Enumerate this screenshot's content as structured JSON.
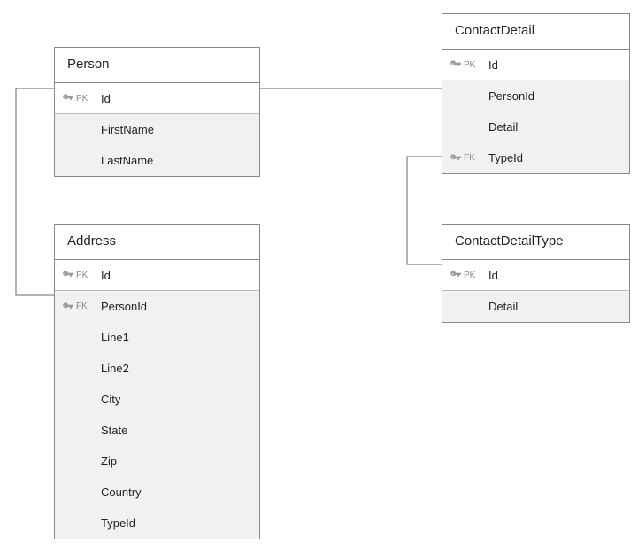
{
  "entities": {
    "person": {
      "title": "Person",
      "cols": {
        "id": {
          "name": "Id",
          "key": "PK"
        },
        "firstName": {
          "name": "FirstName",
          "key": ""
        },
        "lastName": {
          "name": "LastName",
          "key": ""
        }
      }
    },
    "contactDetail": {
      "title": "ContactDetail",
      "cols": {
        "id": {
          "name": "Id",
          "key": "PK"
        },
        "personId": {
          "name": "PersonId",
          "key": ""
        },
        "detail": {
          "name": "Detail",
          "key": ""
        },
        "typeId": {
          "name": "TypeId",
          "key": "FK"
        }
      }
    },
    "address": {
      "title": "Address",
      "cols": {
        "id": {
          "name": "Id",
          "key": "PK"
        },
        "personId": {
          "name": "PersonId",
          "key": "FK"
        },
        "line1": {
          "name": "Line1",
          "key": ""
        },
        "line2": {
          "name": "Line2",
          "key": ""
        },
        "city": {
          "name": "City",
          "key": ""
        },
        "state": {
          "name": "State",
          "key": ""
        },
        "zip": {
          "name": "Zip",
          "key": ""
        },
        "country": {
          "name": "Country",
          "key": ""
        },
        "typeId": {
          "name": "TypeId",
          "key": ""
        }
      }
    },
    "contactDetailType": {
      "title": "ContactDetailType",
      "cols": {
        "id": {
          "name": "Id",
          "key": "PK"
        },
        "detail": {
          "name": "Detail",
          "key": ""
        }
      }
    }
  },
  "relationships": [
    {
      "from": "Person.Id",
      "to": "ContactDetail.PersonId"
    },
    {
      "from": "Person.Id",
      "to": "Address.PersonId"
    },
    {
      "from": "ContactDetail.TypeId",
      "to": "ContactDetailType.Id"
    }
  ]
}
